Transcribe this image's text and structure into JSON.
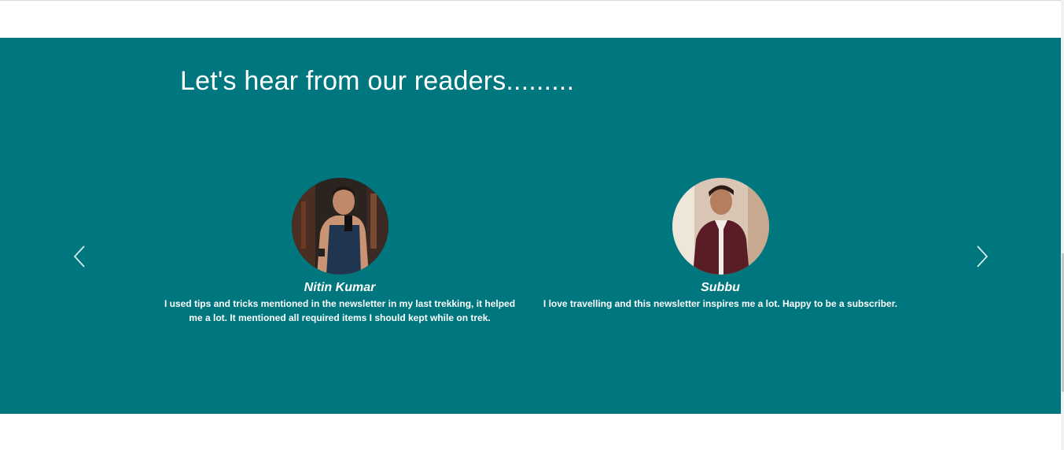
{
  "section": {
    "heading": "Let's hear from our readers.........",
    "background": "#00777e",
    "text_color": "#ffffff"
  },
  "carousel": {
    "prev_icon": "chevron-left-icon",
    "next_icon": "chevron-right-icon",
    "testimonials": [
      {
        "name": "Nitin Kumar",
        "quote": "I used tips and tricks mentioned in the newsletter in my last trekking, it helped me a lot. It mentioned all required items I should kept while on trek."
      },
      {
        "name": "Subbu",
        "quote": "I love travelling and this newsletter inspires me a lot. Happy to be a subscriber."
      }
    ]
  }
}
